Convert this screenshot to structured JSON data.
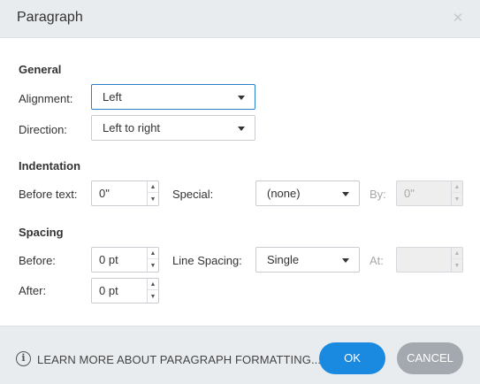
{
  "dialog": {
    "title": "Paragraph"
  },
  "icons": {
    "close": "close-icon",
    "info": "info-icon",
    "caret": "caret-down-icon"
  },
  "general": {
    "heading": "General",
    "alignment_label": "Alignment:",
    "alignment_value": "Left",
    "direction_label": "Direction:",
    "direction_value": "Left to right"
  },
  "indentation": {
    "heading": "Indentation",
    "before_text_label": "Before text:",
    "before_text_value": "0\"",
    "special_label": "Special:",
    "special_value": "(none)",
    "by_label": "By:",
    "by_value": "0\""
  },
  "spacing": {
    "heading": "Spacing",
    "before_label": "Before:",
    "before_value": "0 pt",
    "line_spacing_label": "Line Spacing:",
    "line_spacing_value": "Single",
    "at_label": "At:",
    "at_value": "",
    "after_label": "After:",
    "after_value": "0 pt"
  },
  "footer": {
    "learn_more": "LEARN MORE ABOUT PARAGRAPH FORMATTING...",
    "ok_label": "OK",
    "cancel_label": "CANCEL"
  },
  "colors": {
    "accent": "#1a8ae0",
    "focus_border": "#2b7fc8",
    "cancel_bg": "#a3a9af",
    "chrome_bg": "#e9ecef"
  }
}
